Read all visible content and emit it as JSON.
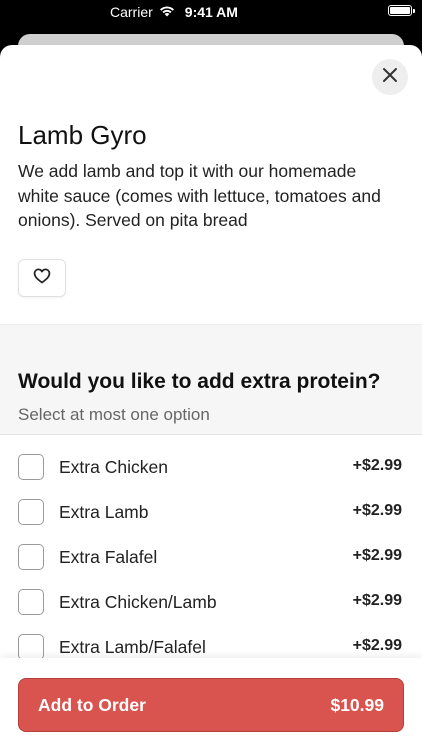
{
  "status_bar": {
    "carrier": "Carrier",
    "time": "9:41 AM"
  },
  "item": {
    "title": "Lamb Gyro",
    "description": "We add lamb and top it with our homemade white sauce (comes with lettuce, tomatoes and onions). Served on pita bread"
  },
  "section": {
    "title": "Would you like to add extra protein?",
    "subtitle": "Select at most one option"
  },
  "options": [
    {
      "label": "Extra Chicken",
      "price": "+$2.99",
      "checked": false
    },
    {
      "label": "Extra Lamb",
      "price": "+$2.99",
      "checked": false
    },
    {
      "label": "Extra Falafel",
      "price": "+$2.99",
      "checked": false
    },
    {
      "label": "Extra Chicken/Lamb",
      "price": "+$2.99",
      "checked": false
    },
    {
      "label": "Extra Lamb/Falafel",
      "price": "+$2.99",
      "checked": false
    }
  ],
  "footer": {
    "add_label": "Add to Order",
    "total": "$10.99"
  },
  "colors": {
    "accent": "#d9534f"
  },
  "icons": {
    "close": "close-icon",
    "favorite": "heart-icon",
    "wifi": "wifi-icon",
    "battery": "battery-icon"
  }
}
